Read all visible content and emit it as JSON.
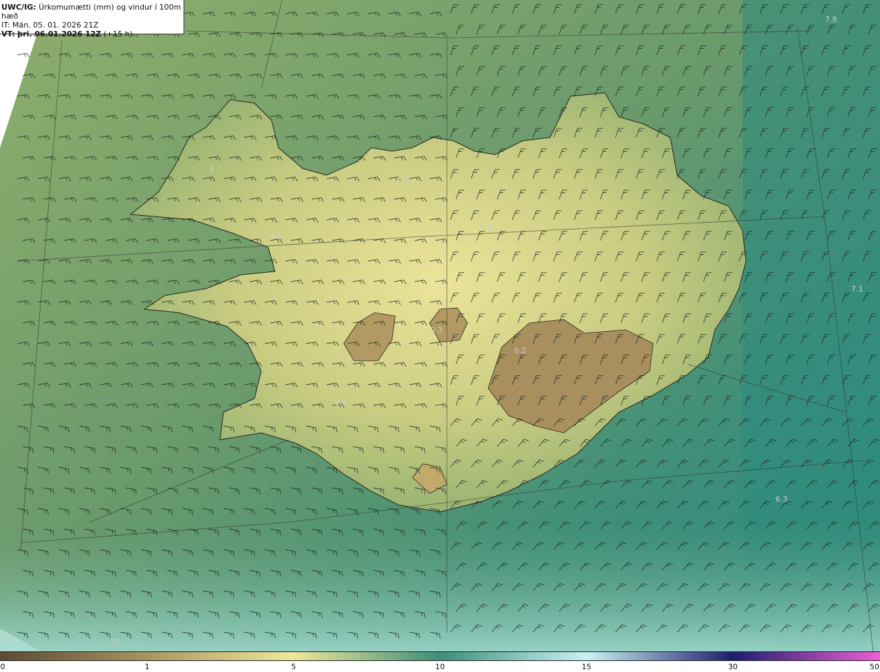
{
  "header": {
    "model": "UWC/IG:",
    "description": "Úrkomumætti (mm) og vindur í 100m hæð",
    "it_line": "IT: Mán. 05. 01. 2026 21Z",
    "vt_prefix": "VT:",
    "vt_date": "þri. 06.01.2026 12Z",
    "vt_lead": "(+15 h)"
  },
  "value_labels": [
    {
      "id": "ne",
      "text": "7.8"
    },
    {
      "id": "nw-fjords",
      "text": "4.0"
    },
    {
      "id": "north",
      "text": "4.9"
    },
    {
      "id": "west",
      "text": "4.6"
    },
    {
      "id": "east",
      "text": "7.1"
    },
    {
      "id": "langjokull",
      "text": "0.3"
    },
    {
      "id": "vatnajokull",
      "text": "0.2"
    },
    {
      "id": "south-west",
      "text": "2.9"
    },
    {
      "id": "south-east-sea",
      "text": "6.3"
    },
    {
      "id": "west-fjords",
      "text": "4"
    },
    {
      "id": "south-sea",
      "text": "10"
    }
  ],
  "colorbar": {
    "ticks": [
      "0",
      "1",
      "5",
      "10",
      "15",
      "30",
      "50"
    ],
    "colors": [
      "#5b4a34",
      "#a8955f",
      "#efe79a",
      "#3c8f79",
      "#c9f2f2",
      "#1d1d6e",
      "#ee5fd8"
    ]
  },
  "colors": {
    "land_low": "#d9d98a",
    "land_high": "#ece79a",
    "sea_near": "#7fa56a",
    "sea_far": "#2f8a7c",
    "ice": "#a78f5d"
  }
}
